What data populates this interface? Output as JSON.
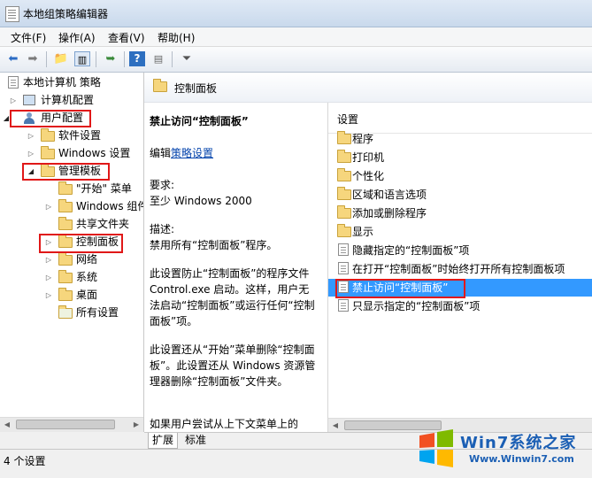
{
  "window": {
    "title": "本地组策略编辑器"
  },
  "menu": [
    "文件(F)",
    "操作(A)",
    "查看(V)",
    "帮助(H)"
  ],
  "toolbar": {
    "icons": [
      "back-arrow-icon",
      "forward-arrow-icon",
      "up-folder-icon",
      "show-hide-tree-icon",
      "export-list-icon",
      "help-icon",
      "properties-icon",
      "filter-icon"
    ]
  },
  "tree": {
    "root": "本地计算机 策略",
    "computer_config": "计算机配置",
    "user_config": "用户配置",
    "software_settings": "软件设置",
    "windows_settings": "Windows 设置",
    "admin_templates": "管理模板",
    "start_menu": "\"开始\" 菜单",
    "windows_components": "Windows 组件",
    "shared_folders": "共享文件夹",
    "control_panel": "控制面板",
    "network": "网络",
    "system": "系统",
    "desktop": "桌面",
    "all_settings": "所有设置"
  },
  "breadcrumb": {
    "title": "控制面板"
  },
  "description": {
    "setting_title": "禁止访问“控制面板”",
    "edit_prefix": "编辑",
    "edit_link": "策略设置",
    "requirements_label": "要求:",
    "requirements_value": "至少 Windows 2000",
    "desc_label": "描述:",
    "desc_line": "禁用所有“控制面板”程序。",
    "para1": "此设置防止“控制面板”的程序文件 Control.exe 启动。这样，用户无法启动“控制面板”或运行任何“控制面板”项。",
    "para2": "此设置还从“开始”菜单删除“控制面板”。此设置还从 Windows 资源管理器删除“控制面板”文件夹。",
    "para3": "如果用户尝试从上下文菜单上的"
  },
  "settings": {
    "header": "设置",
    "items": [
      {
        "label": "程序",
        "icon": "folder-icon"
      },
      {
        "label": "打印机",
        "icon": "folder-icon"
      },
      {
        "label": "个性化",
        "icon": "folder-icon"
      },
      {
        "label": "区域和语言选项",
        "icon": "folder-icon"
      },
      {
        "label": "添加或删除程序",
        "icon": "folder-icon"
      },
      {
        "label": "显示",
        "icon": "folder-icon"
      },
      {
        "label": "隐藏指定的“控制面板”项",
        "icon": "policy-icon"
      },
      {
        "label": "在打开“控制面板”时始终打开所有控制面板项",
        "icon": "policy-icon"
      },
      {
        "label": "禁止访问“控制面板”",
        "icon": "policy-icon",
        "selected": true
      },
      {
        "label": "只显示指定的“控制面板”项",
        "icon": "policy-icon"
      }
    ]
  },
  "tabs": {
    "extended": "扩展",
    "standard": "标准"
  },
  "status": {
    "text": "4 个设置"
  },
  "watermark": {
    "brand": "Win7系统之家",
    "url": "Www.Winwin7.com"
  },
  "colors": {
    "selection": "#3399ff",
    "highlight_box": "#e01818",
    "link": "#0645ad"
  }
}
